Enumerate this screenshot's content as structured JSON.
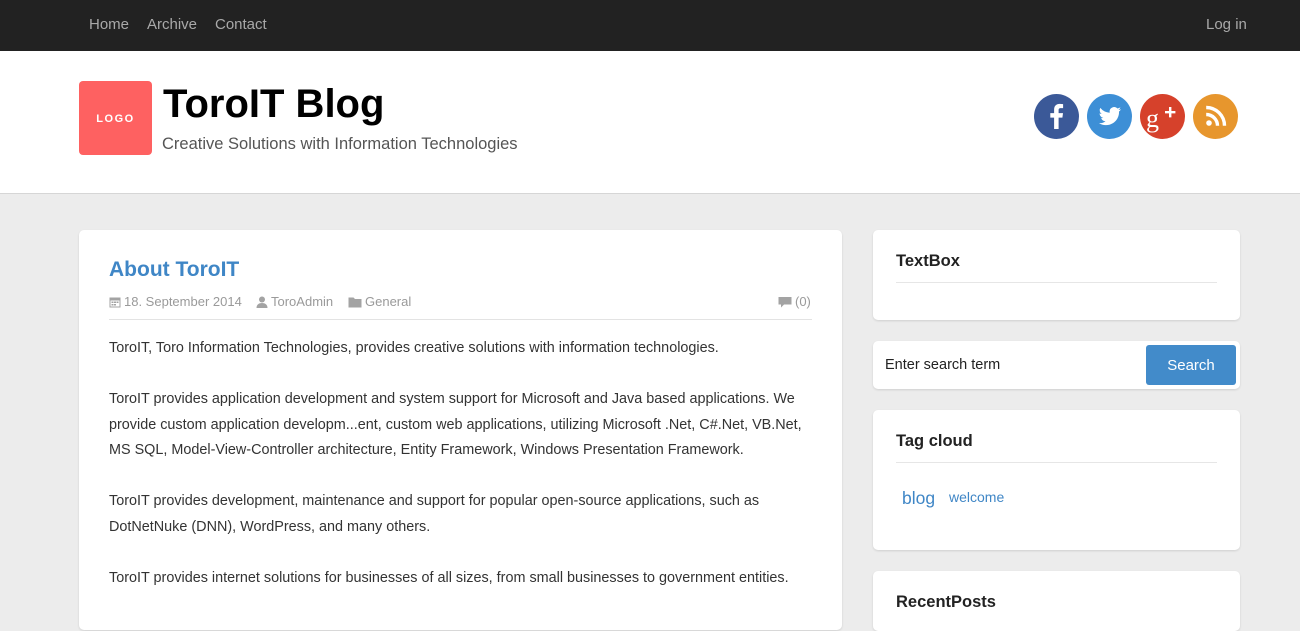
{
  "nav": {
    "home": "Home",
    "archive": "Archive",
    "contact": "Contact",
    "login": "Log in"
  },
  "header": {
    "logo_text": "LOGO",
    "title": "ToroIT Blog",
    "tagline": "Creative Solutions with Information Technologies",
    "social": [
      "facebook-icon",
      "twitter-icon",
      "google-plus-icon",
      "rss-icon"
    ]
  },
  "post": {
    "title": "About ToroIT",
    "date": "18. September 2014",
    "author": "ToroAdmin",
    "category": "General",
    "comments": "(0)",
    "paragraphs": [
      "ToroIT, Toro Information Technologies, provides creative solutions with information technologies.",
      "ToroIT provides application development and system support for Microsoft and Java based applications. We provide custom application developm...ent, custom web applications, utilizing Microsoft .Net, C#.Net, VB.Net, MS SQL, Model-View-Controller architecture, Entity Framework, Windows Presentation Framework.",
      "ToroIT provides development, maintenance and support for popular open-source applications, such as DotNetNuke (DNN), WordPress, and many others.",
      "ToroIT provides internet solutions for businesses of all sizes, from small businesses to government entities."
    ]
  },
  "sidebar": {
    "textbox_title": "TextBox",
    "search": {
      "value": "Enter search term",
      "button": "Search"
    },
    "tagcloud_title": "Tag cloud",
    "tags": [
      "blog",
      "welcome"
    ],
    "recent_title": "RecentPosts"
  },
  "colors": {
    "nav_bg": "#222222",
    "logo": "#fe6161",
    "link": "#3f86c6",
    "search_button": "#428bca",
    "facebook": "#3b5998",
    "twitter": "#3d8fd6",
    "google_plus": "#d6412b",
    "rss": "#e7962d",
    "page_bg": "#ececec"
  }
}
